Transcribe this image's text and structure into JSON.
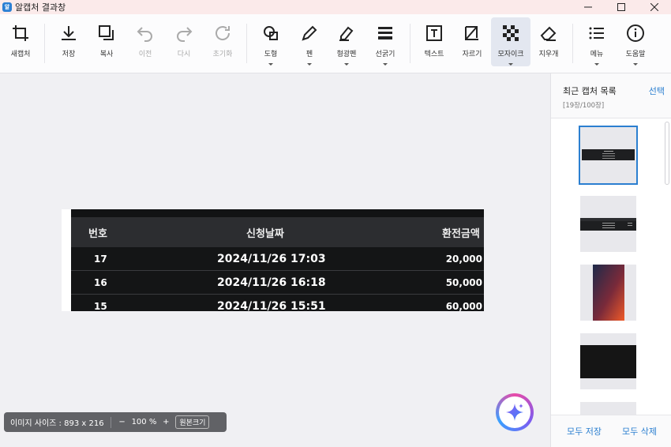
{
  "app": {
    "title": "알캡처 결과창",
    "logo_text": "알"
  },
  "window_controls": [
    "minimize",
    "maximize",
    "close"
  ],
  "toolbar": {
    "new_capture": "새캡처",
    "save": "저장",
    "copy": "복사",
    "undo": "이전",
    "redo": "다시",
    "reset": "초기화",
    "shape": "도형",
    "pen": "펜",
    "highlighter": "형광펜",
    "line_width": "선굵기",
    "text": "텍스트",
    "crop": "자르기",
    "mosaic": "모자이크",
    "eraser": "지우개",
    "menu": "메뉴",
    "help": "도움말"
  },
  "captured_table": {
    "headers": [
      "번호",
      "신청날짜",
      "환전금액"
    ],
    "rows": [
      [
        "17",
        "2024/11/26 17:03",
        "20,000"
      ],
      [
        "16",
        "2024/11/26 16:18",
        "50,000"
      ],
      [
        "15",
        "2024/11/26 15:51",
        "60,000"
      ]
    ]
  },
  "statusbar": {
    "image_size": "이미지 사이즈 : 893 x 216",
    "zoom_out": "−",
    "zoom": "100 %",
    "zoom_in": "+",
    "original_size": "원본크기"
  },
  "panel": {
    "title": "최근 캡처 목록",
    "select": "선택",
    "count": "[19장/100장]",
    "save_all": "모두 저장",
    "delete_all": "모두 삭제"
  },
  "colors": {
    "accent": "#2b7fd0",
    "titlebar_bg": "#fbeaea",
    "captured_bg": "#1e1f21"
  }
}
